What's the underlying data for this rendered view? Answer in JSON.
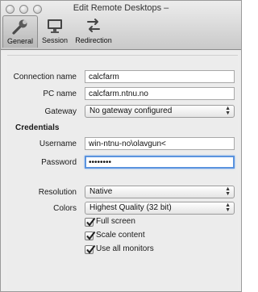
{
  "window": {
    "title": "Edit Remote Desktops –"
  },
  "toolbar": {
    "tabs": [
      {
        "label": "General",
        "icon": "wrench-icon",
        "active": true
      },
      {
        "label": "Session",
        "icon": "monitor-icon",
        "active": false
      },
      {
        "label": "Redirection",
        "icon": "redirection-icon",
        "active": false
      }
    ]
  },
  "general": {
    "connection_name": {
      "label": "Connection name",
      "value": "calcfarm"
    },
    "pc_name": {
      "label": "PC name",
      "value": "calcfarm.ntnu.no"
    },
    "gateway": {
      "label": "Gateway",
      "value": "No gateway configured"
    },
    "credentials_heading": "Credentials",
    "username": {
      "label": "Username",
      "value": "win-ntnu-no\\olavgun<"
    },
    "password": {
      "label": "Password",
      "value": "••••••••"
    },
    "resolution": {
      "label": "Resolution",
      "value": "Native"
    },
    "colors": {
      "label": "Colors",
      "value": "Highest Quality (32 bit)"
    },
    "full_screen": {
      "label": "Full screen",
      "checked": true
    },
    "scale_content": {
      "label": "Scale content",
      "checked": true
    },
    "use_all_monitors": {
      "label": "Use all monitors",
      "checked": true
    }
  },
  "colors": {
    "focus_ring": "#5a93de",
    "check": "#1f1f1f"
  }
}
